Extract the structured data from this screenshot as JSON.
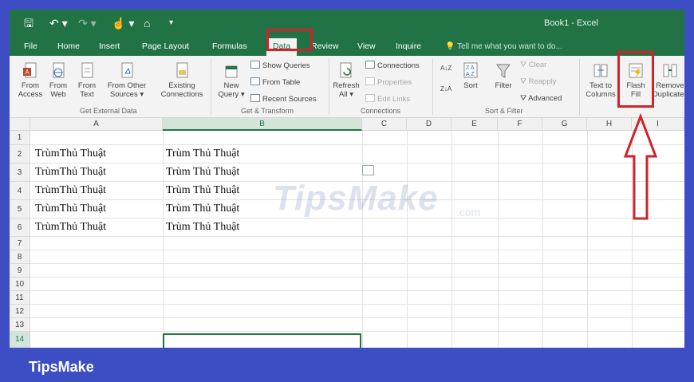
{
  "window": {
    "title": "Book1 - Excel"
  },
  "tabs": [
    "File",
    "Home",
    "Insert",
    "Page Layout",
    "Formulas",
    "Data",
    "Review",
    "View",
    "Inquire"
  ],
  "active_tab": "Data",
  "tell_me": "Tell me what you want to do...",
  "ribbon": {
    "get_external": {
      "from_access": [
        "From",
        "Access"
      ],
      "from_web": [
        "From",
        "Web"
      ],
      "from_text": [
        "From",
        "Text"
      ],
      "from_other": [
        "From Other",
        "Sources ▾"
      ],
      "existing": [
        "Existing",
        "Connections"
      ],
      "label": "Get External Data"
    },
    "get_transform": {
      "new_query": [
        "New",
        "Query ▾"
      ],
      "show_queries": "Show Queries",
      "from_table": "From Table",
      "recent_sources": "Recent Sources",
      "label": "Get & Transform"
    },
    "connections": {
      "refresh": [
        "Refresh",
        "All ▾"
      ],
      "connections": "Connections",
      "properties": "Properties",
      "edit_links": "Edit Links",
      "label": "Connections"
    },
    "sort_filter": {
      "sort": "Sort",
      "filter": "Filter",
      "clear": "Clear",
      "reapply": "Reapply",
      "advanced": "Advanced",
      "label": "Sort & Filter"
    },
    "data_tools": {
      "text_to_columns": [
        "Text to",
        "Columns"
      ],
      "flash_fill": [
        "Flash",
        "Fill"
      ],
      "remove_duplicates": [
        "Remove",
        "Duplicates"
      ]
    }
  },
  "sheet": {
    "columns": [
      "A",
      "B",
      "C",
      "D",
      "E",
      "F",
      "G",
      "H",
      "I"
    ],
    "rows": [
      "1",
      "2",
      "3",
      "4",
      "5",
      "6",
      "7",
      "8",
      "9",
      "10",
      "11",
      "12",
      "13",
      "14"
    ],
    "cells_a": [
      "TrùmThủ Thuật",
      "TrùmThủ Thuật",
      "TrùmThủ Thuật",
      "TrùmThủ Thuật",
      "TrùmThủ Thuật"
    ],
    "cells_b": [
      "Trùm Thủ Thuật",
      "Trùm Thủ Thuật",
      "Trùm Thủ Thuật",
      "Trùm Thủ Thuật",
      "Trùm Thủ Thuật"
    ]
  },
  "watermark": {
    "main": "TipsMake",
    "suffix": ".com"
  },
  "footer": {
    "brand": "TipsMake"
  },
  "colors": {
    "excel_green": "#217346",
    "highlight_red": "#d0222a",
    "frame_blue": "#3d4ec5"
  }
}
